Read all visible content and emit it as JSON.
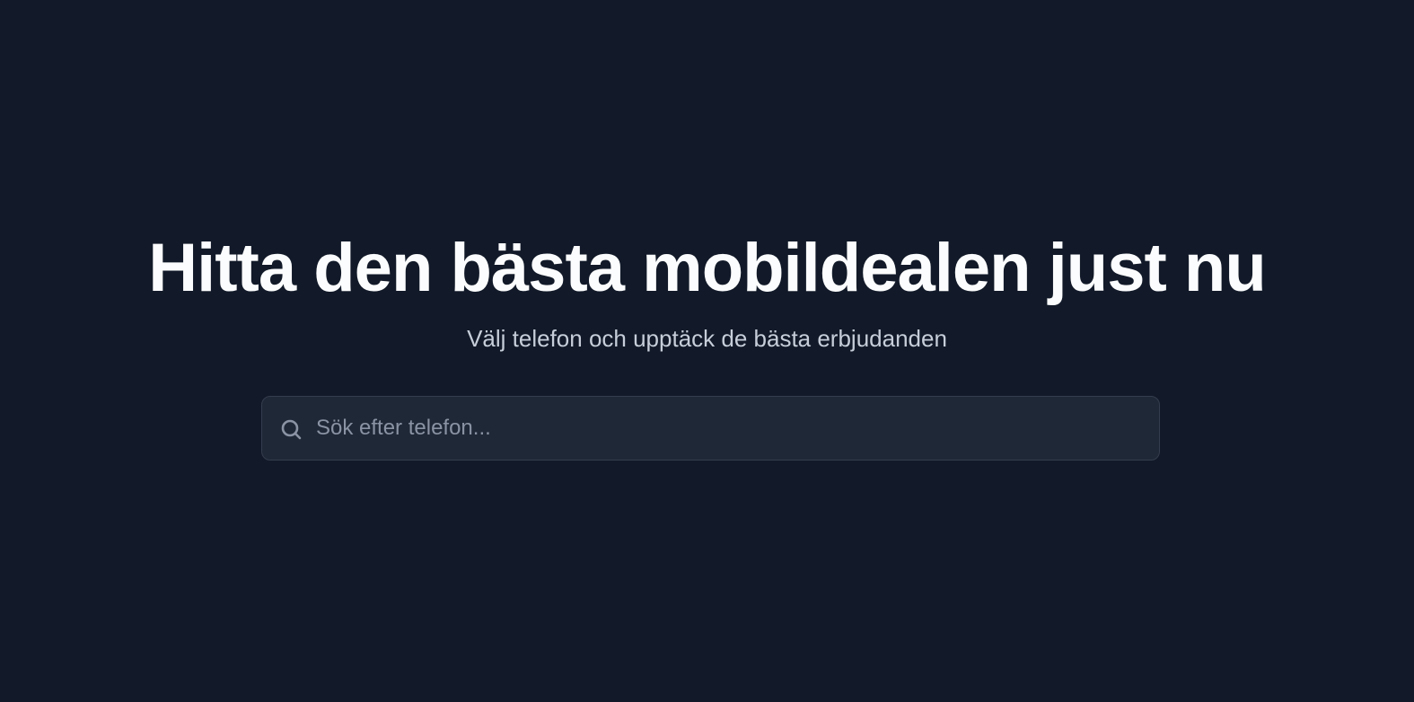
{
  "hero": {
    "title": "Hitta den bästa mobildealen just nu",
    "subtitle": "Välj telefon och upptäck de bästa erbjudanden"
  },
  "search": {
    "placeholder": "Sök efter telefon...",
    "value": "",
    "icon": "search-icon"
  },
  "colors": {
    "background": "#121a29",
    "search_background": "#1f2837",
    "search_border": "#343d4d",
    "title_text": "#fbfcfd",
    "subtitle_text": "#c7ceda",
    "placeholder_text": "#8a93a3"
  }
}
